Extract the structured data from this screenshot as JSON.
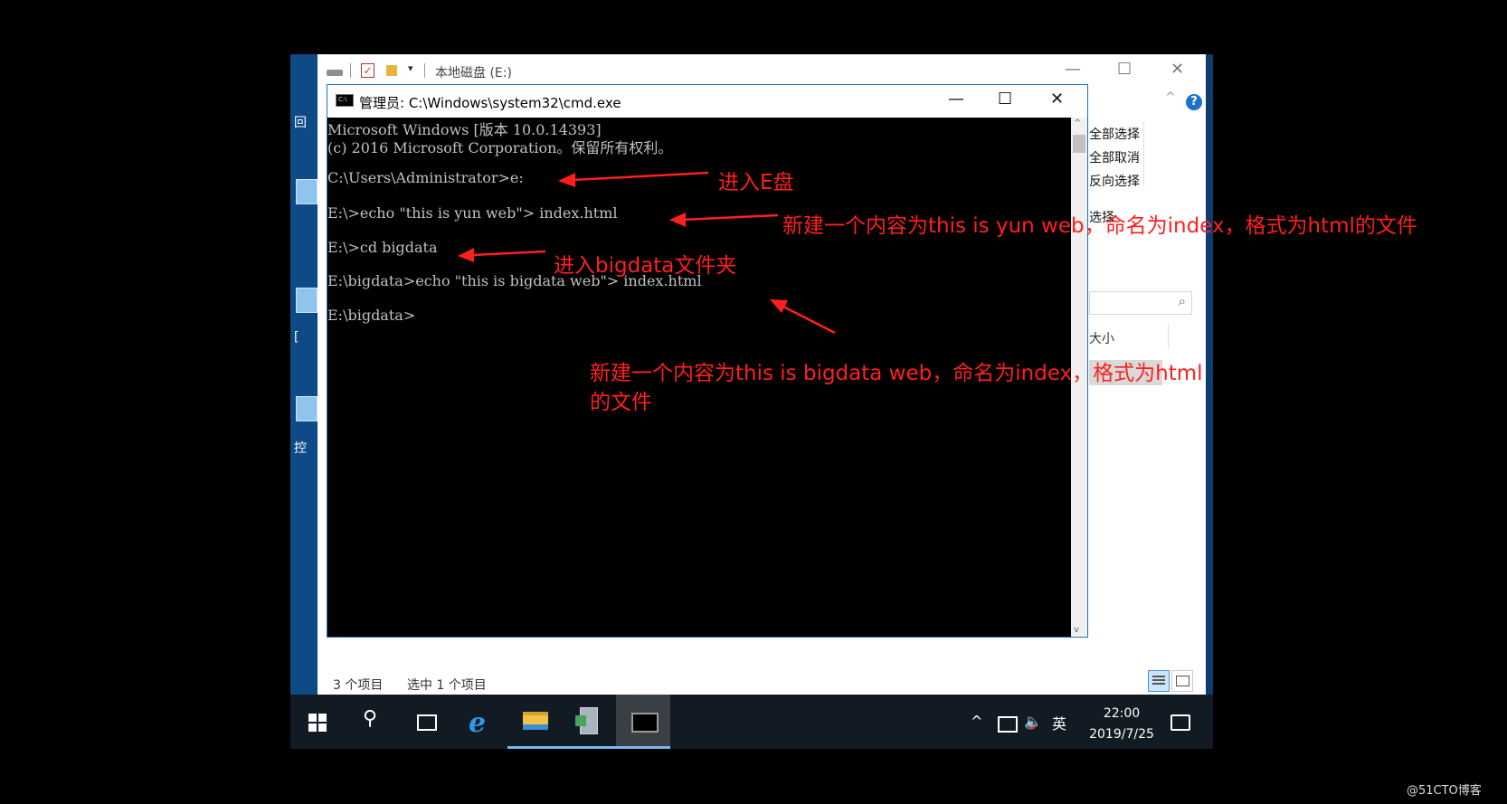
{
  "explorer": {
    "title": "本地磁盘 (E:)",
    "qa_arrow": "▾",
    "minimize": "—",
    "maximize": "☐",
    "close": "✕",
    "help": "?",
    "ribbon_caret": "^",
    "ribbon": [
      "全部选择",
      "全部取消",
      "反向选择",
      "选择"
    ],
    "search_icon": "⌕",
    "column_size": "大小",
    "status_items": "3 个项目",
    "status_selected": "选中 1 个项目"
  },
  "desktop": {
    "label_1": "回",
    "label_2": "[",
    "label_3": "控"
  },
  "cmd": {
    "title": "管理员: C:\\Windows\\system32\\cmd.exe",
    "minimize": "—",
    "maximize": "☐",
    "close": "✕",
    "lines": [
      "Microsoft Windows [版本 10.0.14393]",
      "(c) 2016 Microsoft Corporation。保留所有权利。",
      "C:\\Users\\Administrator>e:",
      "E:\\>echo \"this is yun web\"> index.html",
      "E:\\>cd bigdata",
      "E:\\bigdata>echo \"this is bigdata web\"> index.html",
      "E:\\bigdata>"
    ],
    "scroll_up": "^",
    "scroll_down": "v"
  },
  "annotations": {
    "a1": "进入E盘",
    "a2": "新建一个内容为this is yun web，命名为index，格式为html的文件",
    "a3": "进入bigdata文件夹",
    "a4_line1": "新建一个内容为this is bigdata web，命名为index，格式为html",
    "a4_line2": "的文件"
  },
  "taskbar": {
    "search_glyph": "⚲",
    "ie_glyph": "e",
    "tray_caret": "^",
    "volume": "🔈",
    "ime": "英",
    "time": "22:00",
    "date": "2019/7/25"
  },
  "watermark": "@51CTO博客",
  "colors": {
    "annotation": "#ff1f1f",
    "taskbar": "#121a24",
    "console_bg": "#000000",
    "console_text": "#c0c0c0",
    "window_border": "#1f6fc7"
  }
}
